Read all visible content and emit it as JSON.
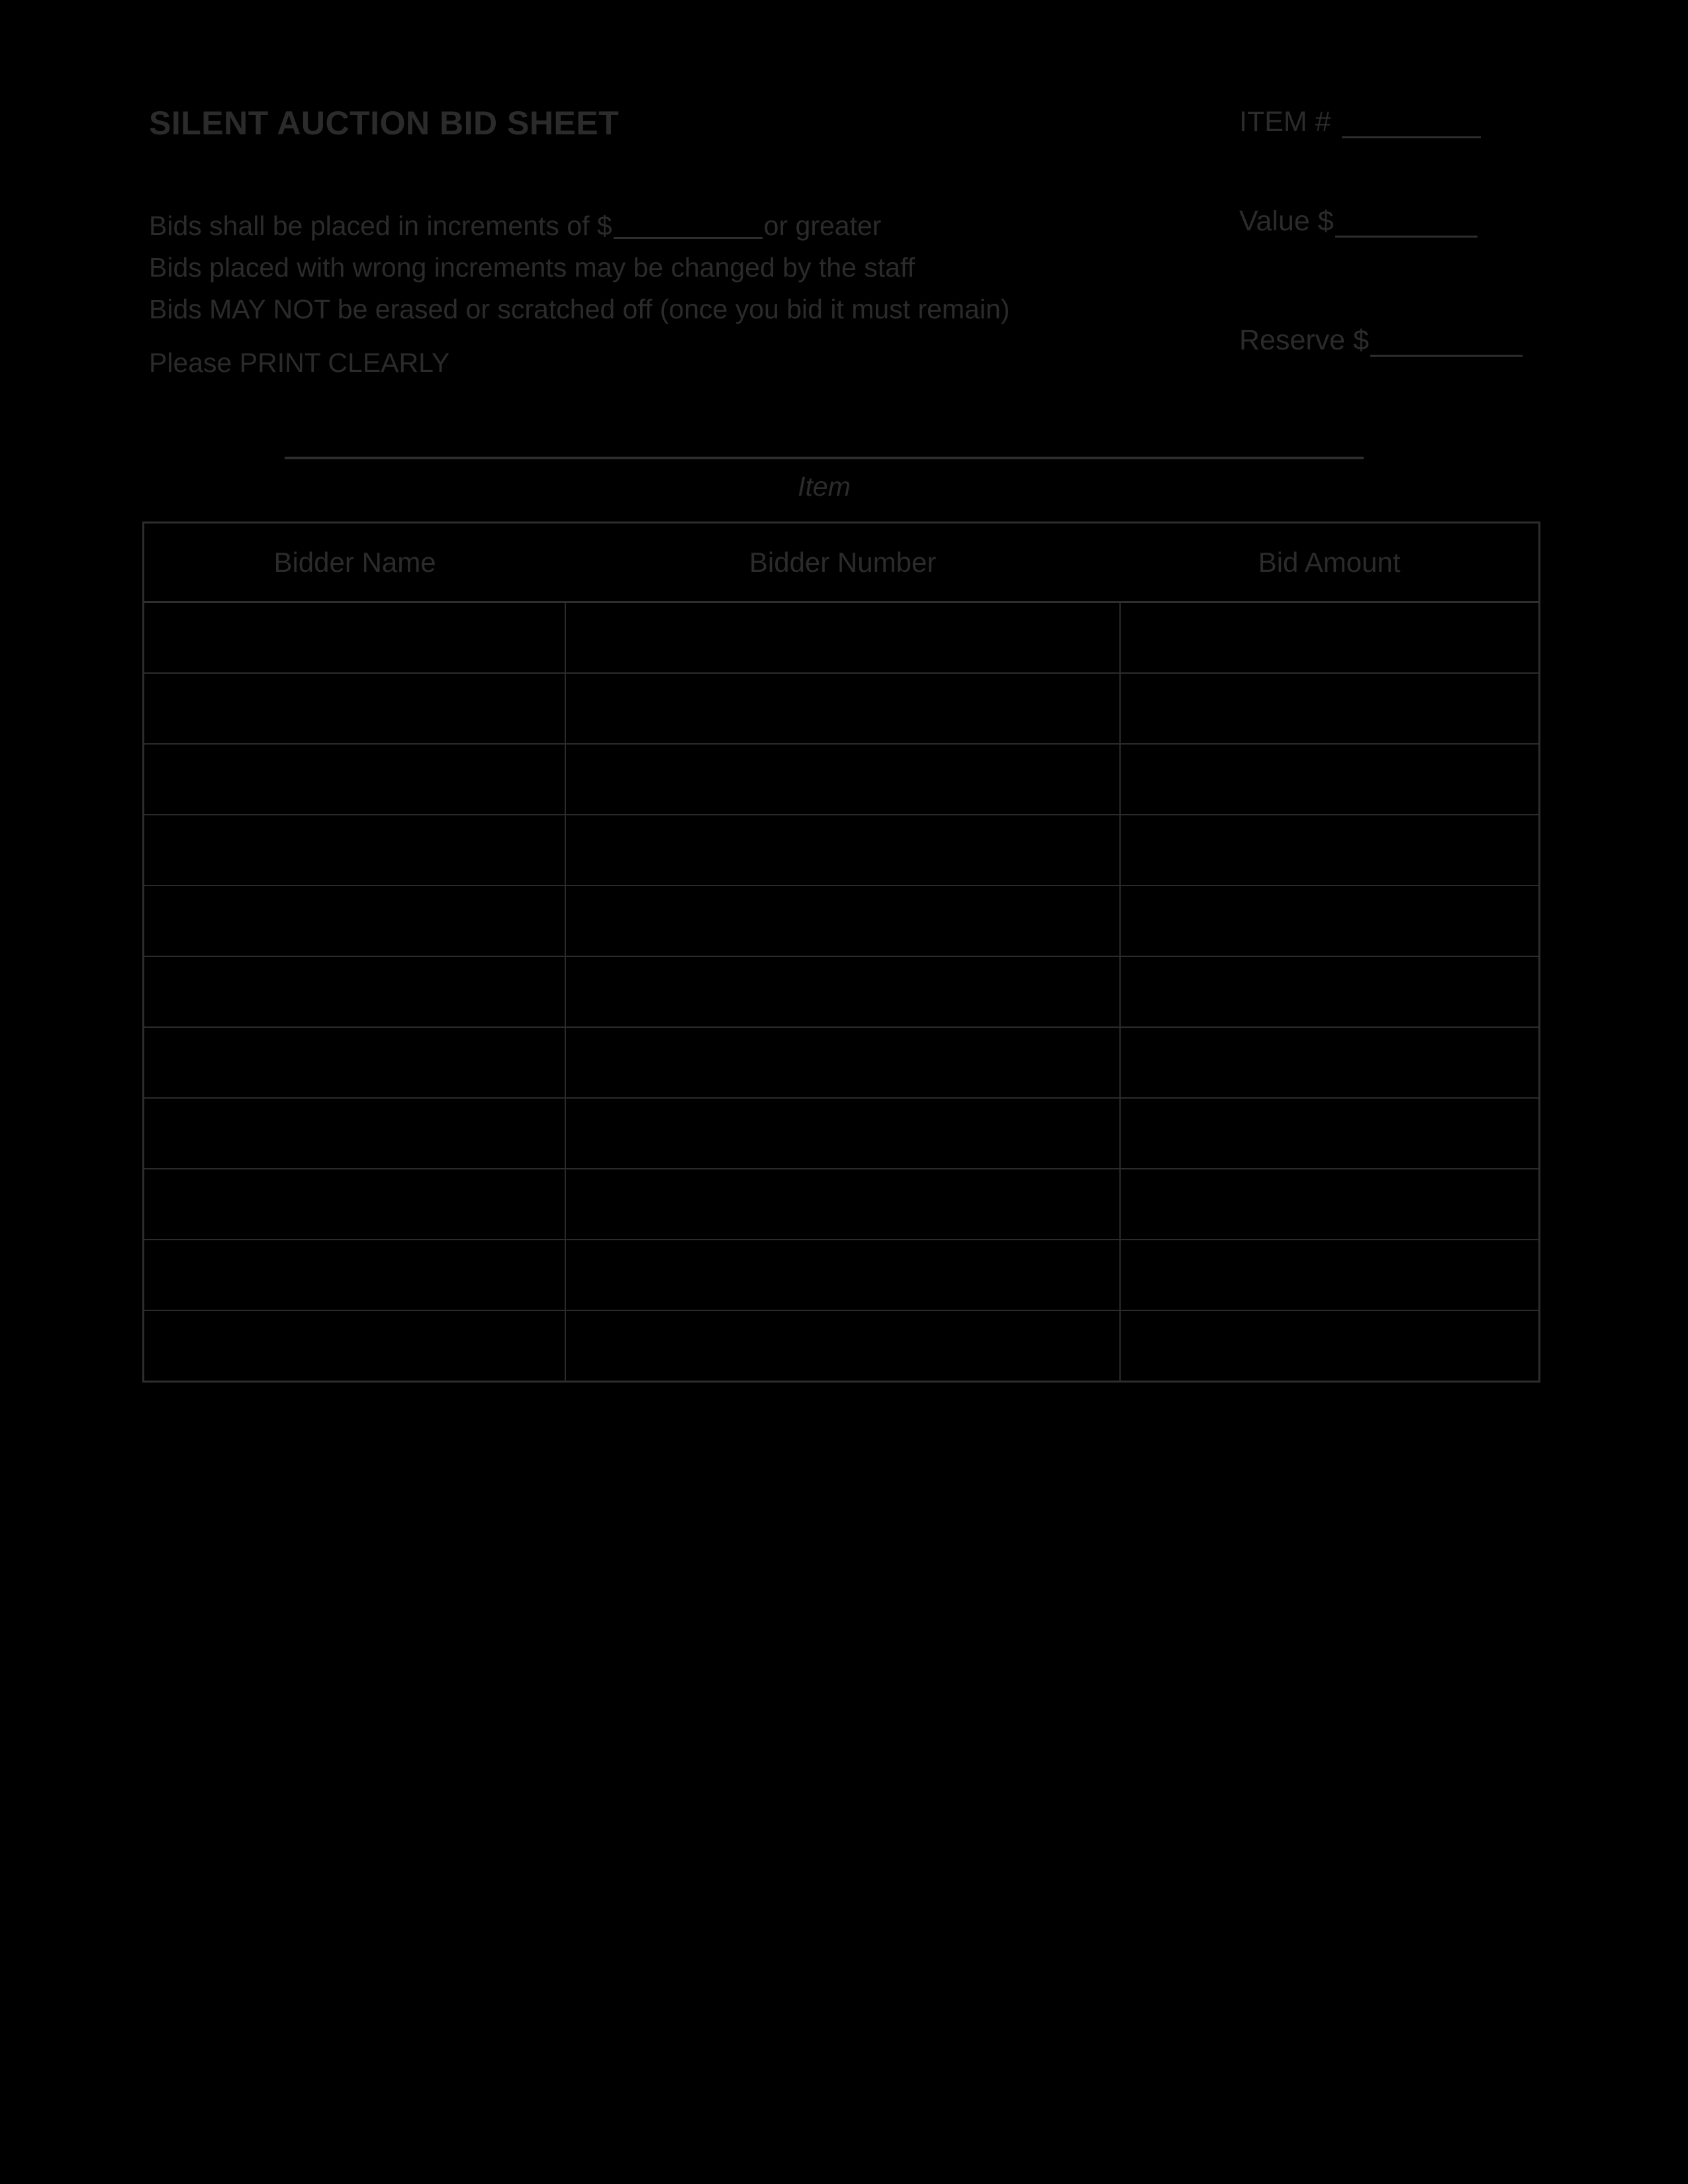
{
  "document": {
    "title": "SILENT AUCTION BID SHEET"
  },
  "instructions": {
    "line1_before": "Bids shall be placed in increments of $",
    "line1_after": "or greater",
    "line2": "Bids placed with wrong increments may be changed by the staff",
    "line3": "Bids MAY NOT be erased or scratched off (once you bid it must remain)",
    "line4": "Please PRINT CLEARLY"
  },
  "fields": {
    "item_number_label": "ITEM #",
    "item_number_value": "",
    "value_label": "Value $",
    "value_value": "",
    "reserve_label": "Reserve $",
    "reserve_value": ""
  },
  "item_line": {
    "caption": "Item",
    "value": ""
  },
  "table": {
    "headers": [
      "Bidder Name",
      "Bidder Number",
      "Bid Amount"
    ],
    "rows": [
      [
        "",
        "",
        ""
      ],
      [
        "",
        "",
        ""
      ],
      [
        "",
        "",
        ""
      ],
      [
        "",
        "",
        ""
      ],
      [
        "",
        "",
        ""
      ],
      [
        "",
        "",
        ""
      ],
      [
        "",
        "",
        ""
      ],
      [
        "",
        "",
        ""
      ],
      [
        "",
        "",
        ""
      ],
      [
        "",
        "",
        ""
      ],
      [
        "",
        "",
        ""
      ]
    ]
  },
  "colors": {
    "background": "#000000",
    "ink": "#2b2b2b",
    "rule": "#2e2e2e"
  }
}
